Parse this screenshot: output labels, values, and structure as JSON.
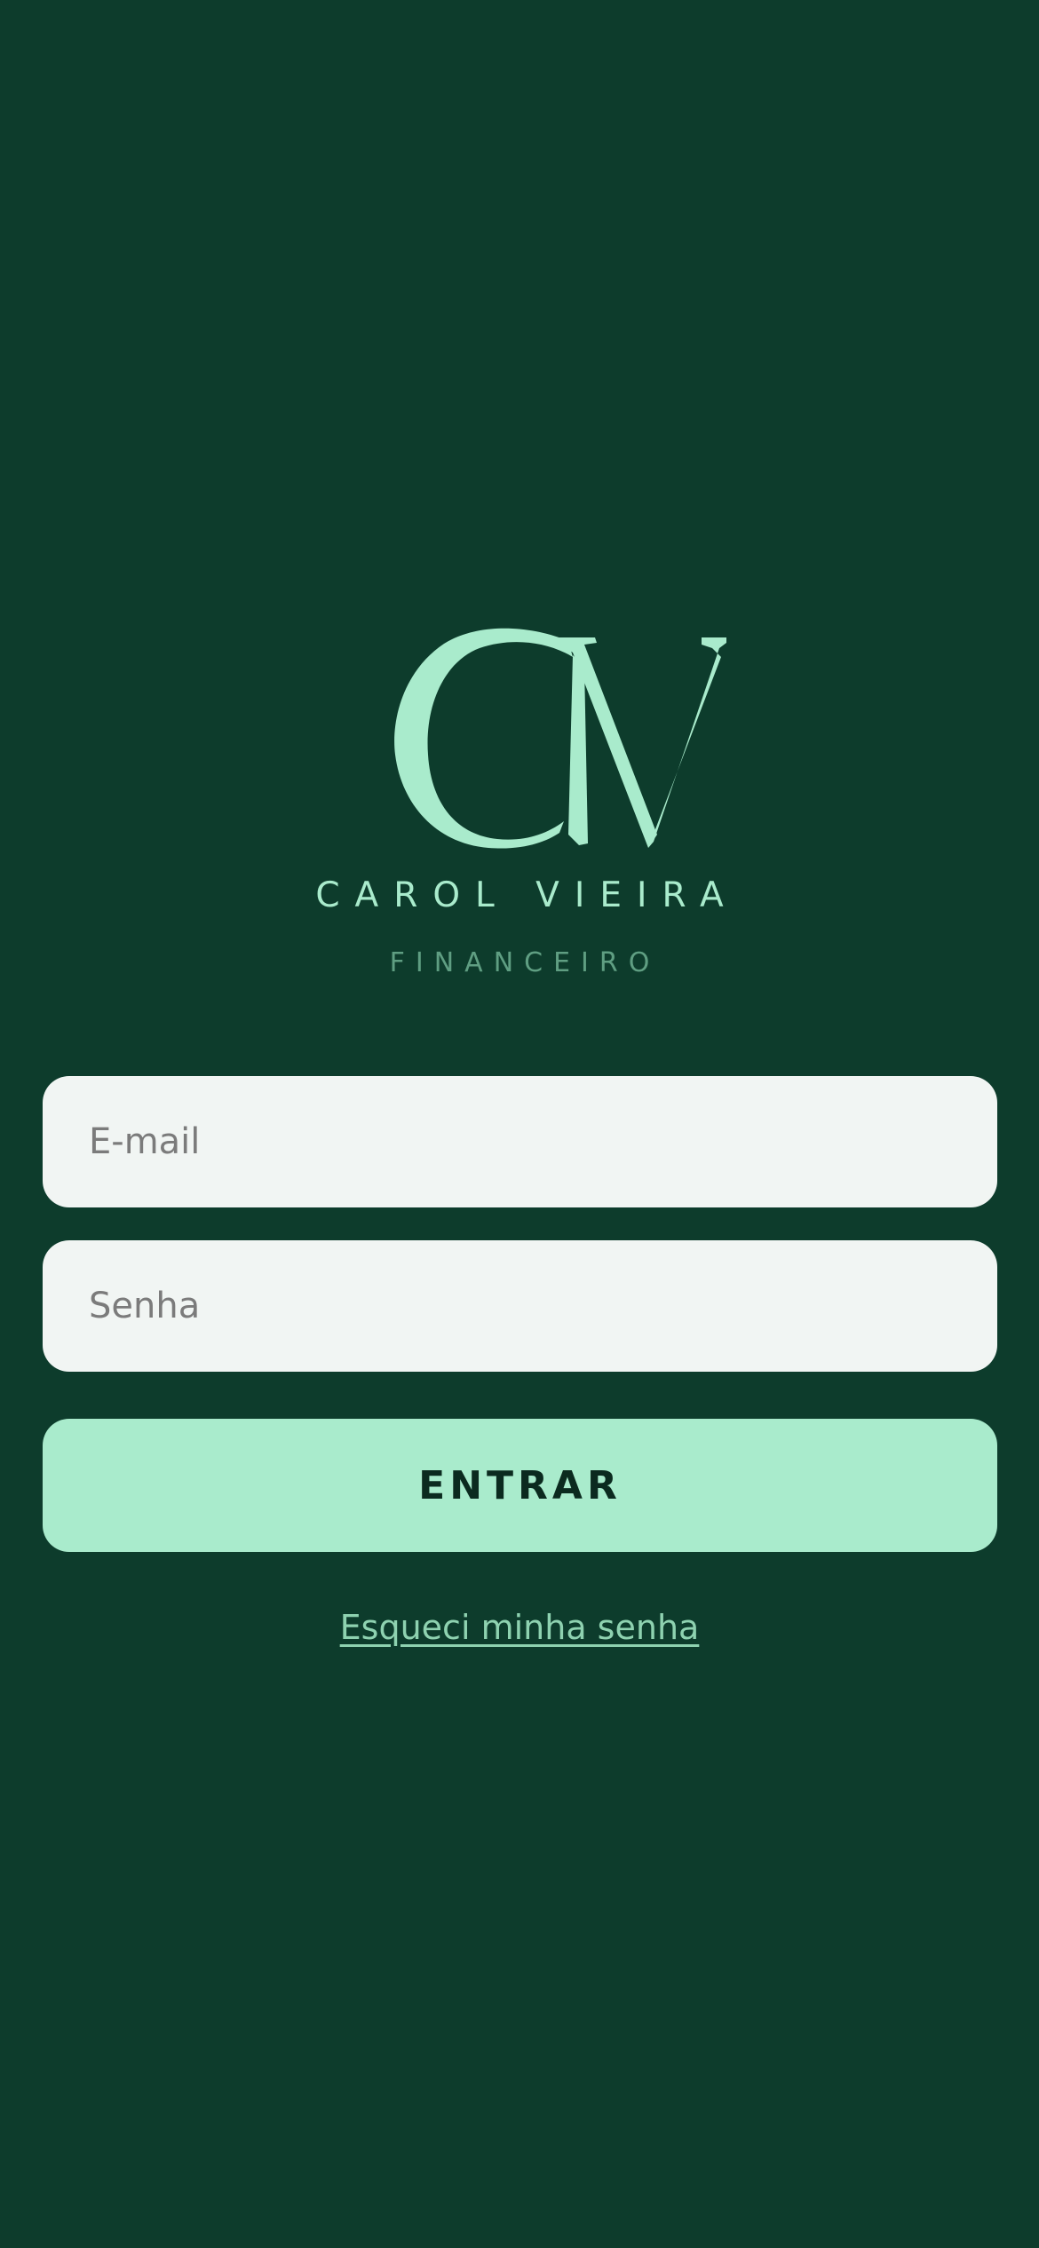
{
  "brand": {
    "name": "CAROL VIEIRA",
    "subtitle": "FINANCEIRO",
    "logo_letters": "CV"
  },
  "form": {
    "email_placeholder": "E-mail",
    "email_value": "",
    "password_placeholder": "Senha",
    "password_value": "",
    "submit_label": "ENTRAR",
    "forgot_label": "Esqueci minha senha"
  },
  "colors": {
    "background": "#0d3c2c",
    "accent": "#a9ebcc",
    "subtitle": "#5f9e82",
    "field_bg": "#f1f5f3",
    "button_text": "#0b2a1f",
    "link": "#8ed2b0"
  },
  "icons": {
    "logo": "cv-monogram-logo-icon"
  }
}
